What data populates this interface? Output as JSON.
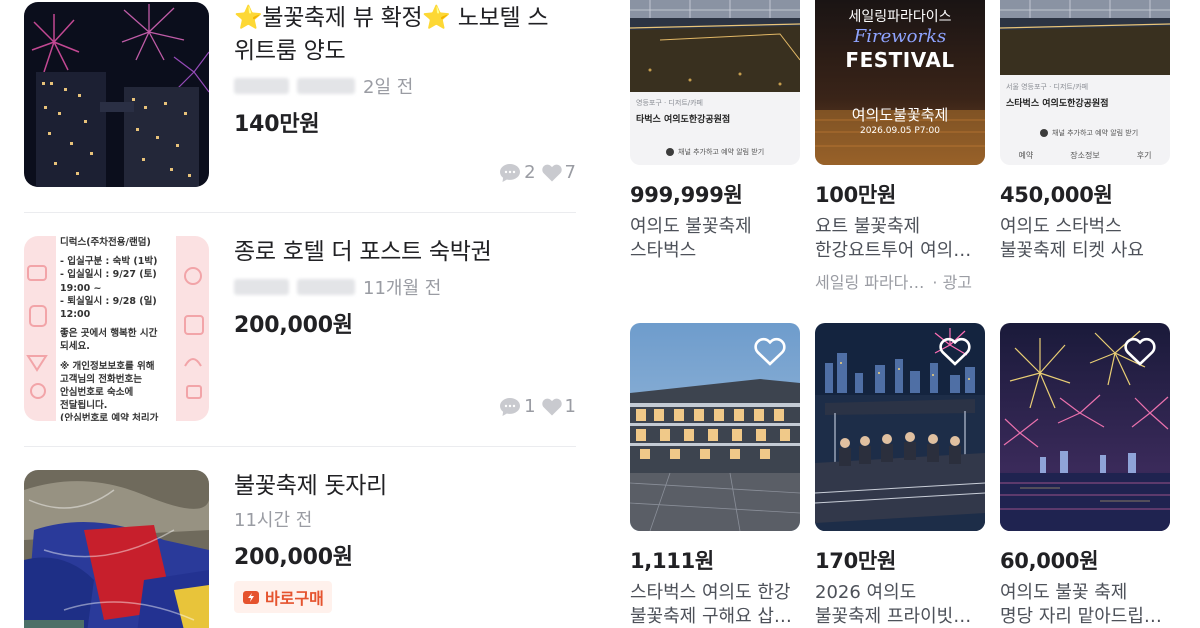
{
  "left_list": [
    {
      "title_line1": "⭐불꽃축제 뷰 확정⭐ 노보텔 스",
      "title_line2": "위트룸 양도",
      "time": "2일 전",
      "price": "140만원",
      "chat_count": "2",
      "like_count": "7"
    },
    {
      "title_line1": "종로 호텔 더 포스트 숙박권",
      "time": "11개월 전",
      "price": "200,000원",
      "chat_count": "1",
      "like_count": "1",
      "thumb_text": [
        "디럭스(주차전용/랜덤)",
        "",
        "- 입실구분 : 숙박 (1박)",
        "- 입실일시 : 9/27 (토)",
        "19:00 ~",
        "- 퇴실일시 : 9/28 (일)",
        "12:00",
        "",
        "좋은 곳에서 행복한 시간",
        "되세요.",
        "",
        "※ 개인정보보호를 위해",
        "고객님의 전화번호는",
        "안심번호로 숙소에",
        "전달됩니다.",
        "(안심번호로 예약 처리가"
      ]
    },
    {
      "title_line1": "불꽃축제 돗자리",
      "time": "11시간 전",
      "price": "200,000원",
      "badge": "바로구매"
    }
  ],
  "grid": [
    {
      "price": "999,999원",
      "title_line1": "여의도 불꽃축제",
      "title_line2": "스타벅스",
      "brochure_location": "영등포구 · 디저트/카페",
      "brochure_name": "타벅스 여의도한강공원점",
      "brochure_cta": "채널 추가하고 예약 알림 받기"
    },
    {
      "price": "100만원",
      "title_line1": "요트 불꽃축제",
      "title_line2": "한강요트투어 여의…",
      "advertiser": "세일링 파라다…",
      "ad_label": "· 광고",
      "poster_brand": "세일링파라다이스",
      "poster_script": "Fireworks",
      "poster_festival": "FESTIVAL",
      "poster_title": "여의도불꽃축제",
      "poster_date": "2026.09.05  P7:00"
    },
    {
      "price": "450,000원",
      "title_line1": "여의도 스타벅스",
      "title_line2": "불꽃축제 티켓 사요",
      "brochure_location": "서울 영등포구 · 디저트/카페",
      "brochure_name": "스타벅스 여의도한강공원점",
      "brochure_cta": "채널 추가하고 예약 알림 받기",
      "brochure_tabs": [
        "예약",
        "장소정보",
        "후기"
      ]
    },
    {
      "price": "1,111원",
      "title_line1": "스타벅스 여의도 한강",
      "title_line2": "불꽃축제 구해요 삽…"
    },
    {
      "price": "170만원",
      "title_line1": "2026 여의도",
      "title_line2": "불꽃축제 프라이빗…"
    },
    {
      "price": "60,000원",
      "title_line1": "여의도 불꽃 축제",
      "title_line2": "명당 자리 맡아드립…"
    }
  ],
  "colors": {
    "price": "#212124",
    "muted": "#9a9ca3",
    "badge": "#e5532e"
  },
  "icons": [
    "chat-icon",
    "heart-icon",
    "lightning-icon"
  ]
}
